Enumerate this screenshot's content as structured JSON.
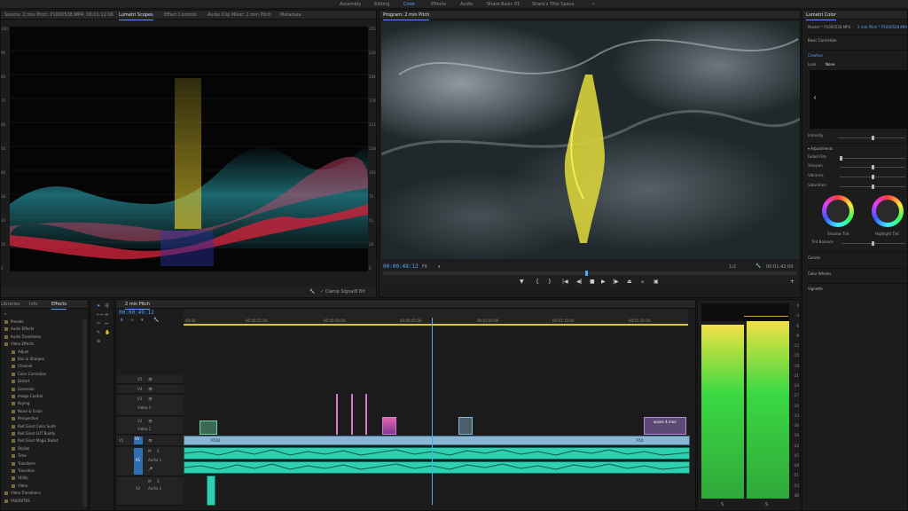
{
  "workspaces": {
    "items": [
      "Assembly",
      "Editing",
      "Color",
      "Effects",
      "Audio",
      "Share Basic 01",
      "Share's Title Space"
    ],
    "active_index": 2,
    "more_icon": "double-chevron-right-icon"
  },
  "source_panel": {
    "tabs": [
      "Source: 2 min Pitch: P1000538.MP4: 00:01:12:06",
      "Lumetri Scopes",
      "Effect Controls",
      "Audio Clip Mixer: 2 min Pitch",
      "Metadata"
    ],
    "active_tab": 1,
    "scale_left": [
      "100",
      "90",
      "80",
      "70",
      "60",
      "50",
      "40",
      "30",
      "20",
      "10",
      "0"
    ],
    "scale_right": [
      "255",
      "230",
      "204",
      "178",
      "153",
      "128",
      "102",
      "76",
      "51",
      "26",
      "0"
    ],
    "clamp_label": "Clamp Signal",
    "bit_depth": "8 Bit"
  },
  "program": {
    "title": "Program: 2 min Pitch",
    "timecode": "00:00:49:12",
    "fit": "Fit",
    "resolution": "1/2",
    "duration": "00:01:42:00",
    "playhead_fraction": 0.49
  },
  "lumetri_color": {
    "title": "Lumetri Color",
    "master": "Master * P1000528.MP4",
    "sequence": "2 min Pitch * P1000528.MP4",
    "basic_correction": "Basic Correction",
    "creative": "Creative",
    "look_label": "Look",
    "look_value": "None",
    "intensity": "Intensity",
    "adjustments": "Adjustments",
    "faded_film": "Faded Film",
    "sharpen": "Sharpen",
    "vibrance": "Vibrance",
    "saturation": "Saturation",
    "shadow_tint": "Shadow Tint",
    "highlight_tint": "Highlight Tint",
    "tint_balance": "Tint Balance",
    "curves": "Curves",
    "color_wheels": "Color Wheels",
    "vignette": "Vignette"
  },
  "effects_panel": {
    "tabs": [
      "Libraries",
      "Info",
      "Effects"
    ],
    "active_tab": 2,
    "items": [
      "Presets",
      "Audio Effects",
      "Audio Transitions",
      "Video Effects",
      "Adjust",
      "Blur & Sharpen",
      "Channel",
      "Color Correction",
      "Distort",
      "Generate",
      "Image Control",
      "Keying",
      "Noise & Grain",
      "Perspective",
      "Red Giant Color Suite",
      "Red Giant LUT Buddy",
      "Red Giant Magic Bullet",
      "Stylize",
      "Time",
      "Transform",
      "Transition",
      "Utility",
      "Video",
      "Video Transitions",
      "FAVORITES"
    ]
  },
  "timeline": {
    "title": "2 min Pitch",
    "timecode": "00:00:49:12",
    "ruler": [
      "00:00",
      "00:00:15:00",
      "00:00:30:00",
      "00:00:45:00",
      "00:01:00:00",
      "00:01:15:00",
      "00:01:30:00"
    ],
    "tracks_video": [
      {
        "id": "V5",
        "name": ""
      },
      {
        "id": "V4",
        "name": ""
      },
      {
        "id": "V3",
        "name": "Video 3"
      },
      {
        "id": "V2",
        "name": "Video 2"
      },
      {
        "id": "V1",
        "name": ""
      }
    ],
    "tracks_audio": [
      {
        "id": "A1",
        "name": "Audio 1"
      },
      {
        "id": "A2",
        "name": "Audio 2"
      }
    ],
    "source_v": "V1",
    "clip_labels": [
      "P100",
      "P10",
      "waine 4.mov"
    ],
    "playhead_fraction": 0.49
  },
  "meters": {
    "scale": [
      "0",
      "-3",
      "-6",
      "-9",
      "-12",
      "-15",
      "-18",
      "-21",
      "-24",
      "-27",
      "-30",
      "-33",
      "-36",
      "-39",
      "-42",
      "-45",
      "-48",
      "-51",
      "-54",
      "dB"
    ],
    "solo": [
      "S",
      "S"
    ]
  },
  "colors": {
    "accent": "#5aa3ff",
    "video_clip": "#8ab6d6",
    "audio_clip": "#2fd0b0",
    "meter_green": "#3bd943",
    "meter_yellow": "#f4e04a"
  }
}
